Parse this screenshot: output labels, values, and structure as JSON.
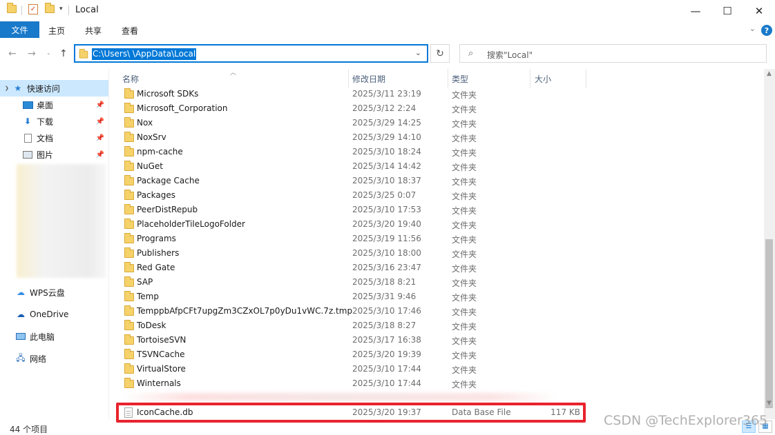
{
  "window": {
    "title": "Local",
    "minimize_glyph": "—",
    "maximize_glyph": "☐",
    "close_glyph": "✕"
  },
  "ribbon": {
    "tabs": [
      "文件",
      "主页",
      "共享",
      "查看"
    ],
    "help_glyph": "?"
  },
  "address": {
    "path": "C:\\Users\\          \\AppData\\Local",
    "search_placeholder": "搜索\"Local\""
  },
  "sidebar": {
    "quick_access": "快速访问",
    "pinned": [
      {
        "label": "桌面",
        "icon": "desktop-icon"
      },
      {
        "label": "下载",
        "icon": "download-icon"
      },
      {
        "label": "文档",
        "icon": "documents-icon"
      },
      {
        "label": "图片",
        "icon": "pictures-icon"
      }
    ],
    "locations": [
      {
        "label": "WPS云盘",
        "icon": "cloud-icon"
      },
      {
        "label": "OneDrive",
        "icon": "onedrive-icon"
      },
      {
        "label": "此电脑",
        "icon": "computer-icon"
      },
      {
        "label": "网络",
        "icon": "network-icon"
      }
    ]
  },
  "columns": {
    "name": "名称",
    "date": "修改日期",
    "type": "类型",
    "size": "大小"
  },
  "files": [
    {
      "name": "Microsoft SDKs",
      "date": "2025/3/11 23:19",
      "type": "文件夹",
      "size": ""
    },
    {
      "name": "Microsoft_Corporation",
      "date": "2025/3/12 2:24",
      "type": "文件夹",
      "size": ""
    },
    {
      "name": "Nox",
      "date": "2025/3/29 14:25",
      "type": "文件夹",
      "size": ""
    },
    {
      "name": "NoxSrv",
      "date": "2025/3/29 14:10",
      "type": "文件夹",
      "size": ""
    },
    {
      "name": "npm-cache",
      "date": "2025/3/10 18:24",
      "type": "文件夹",
      "size": ""
    },
    {
      "name": "NuGet",
      "date": "2025/3/14 14:42",
      "type": "文件夹",
      "size": ""
    },
    {
      "name": "Package Cache",
      "date": "2025/3/10 18:37",
      "type": "文件夹",
      "size": ""
    },
    {
      "name": "Packages",
      "date": "2025/3/25 0:07",
      "type": "文件夹",
      "size": ""
    },
    {
      "name": "PeerDistRepub",
      "date": "2025/3/10 17:53",
      "type": "文件夹",
      "size": ""
    },
    {
      "name": "PlaceholderTileLogoFolder",
      "date": "2025/3/20 19:40",
      "type": "文件夹",
      "size": ""
    },
    {
      "name": "Programs",
      "date": "2025/3/19 11:56",
      "type": "文件夹",
      "size": ""
    },
    {
      "name": "Publishers",
      "date": "2025/3/10 18:00",
      "type": "文件夹",
      "size": ""
    },
    {
      "name": "Red Gate",
      "date": "2025/3/16 23:47",
      "type": "文件夹",
      "size": ""
    },
    {
      "name": "SAP",
      "date": "2025/3/18 8:21",
      "type": "文件夹",
      "size": ""
    },
    {
      "name": "Temp",
      "date": "2025/3/31 9:46",
      "type": "文件夹",
      "size": ""
    },
    {
      "name": "TemppbAfpCFt7upgZm3CZxOL7p0yDu1vWC.7z.tmp",
      "date": "2025/3/10 17:46",
      "type": "文件夹",
      "size": ""
    },
    {
      "name": "ToDesk",
      "date": "2025/3/18 8:27",
      "type": "文件夹",
      "size": ""
    },
    {
      "name": "TortoiseSVN",
      "date": "2025/3/17 16:38",
      "type": "文件夹",
      "size": ""
    },
    {
      "name": "TSVNCache",
      "date": "2025/3/20 19:39",
      "type": "文件夹",
      "size": ""
    },
    {
      "name": "VirtualStore",
      "date": "2025/3/10 17:44",
      "type": "文件夹",
      "size": ""
    },
    {
      "name": "Winternals",
      "date": "2025/3/10 17:44",
      "type": "文件夹",
      "size": ""
    }
  ],
  "highlighted_file": {
    "name": "IconCache.db",
    "date": "2025/3/20 19:37",
    "type": "Data Base File",
    "size": "117 KB"
  },
  "status": {
    "item_count": "44 个项目"
  },
  "watermark": "CSDN @TechExplorer365",
  "colors": {
    "accent": "#0078d7",
    "ribbon_file": "#1979ca",
    "highlight_border": "#e8232c",
    "selected_bg": "#cce8ff"
  }
}
